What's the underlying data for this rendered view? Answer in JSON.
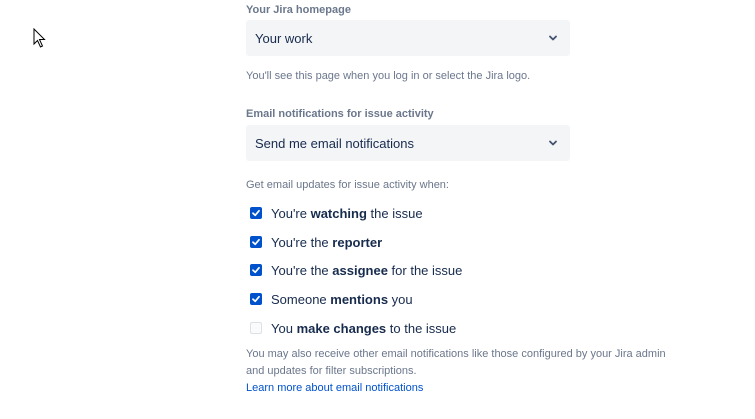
{
  "homepage": {
    "label": "Your Jira homepage",
    "value": "Your work",
    "helper": "You'll see this page when you log in or select the Jira logo."
  },
  "email": {
    "label": "Email notifications for issue activity",
    "value": "Send me email notifications",
    "helper": "Get email updates for issue activity when:"
  },
  "options": [
    {
      "pre": "You're ",
      "bold": "watching",
      "post": " the issue",
      "checked": true
    },
    {
      "pre": "You're the ",
      "bold": "reporter",
      "post": "",
      "checked": true
    },
    {
      "pre": "You're the ",
      "bold": "assignee",
      "post": " for the issue",
      "checked": true
    },
    {
      "pre": "Someone ",
      "bold": "mentions",
      "post": " you",
      "checked": true
    },
    {
      "pre": "You ",
      "bold": "make changes",
      "post": " to the issue",
      "checked": false
    }
  ],
  "footer": {
    "text": "You may also receive other email notifications like those configured by your Jira admin and updates for filter subscriptions.",
    "link": "Learn more about email notifications"
  },
  "colors": {
    "accent": "#0052cc",
    "muted_text": "#6b778c",
    "field_bg": "#f4f5f7"
  },
  "icons": {
    "cursor": "mouse-pointer-icon",
    "dropdown": "chevron-down-icon",
    "checkbox": "check-icon"
  }
}
